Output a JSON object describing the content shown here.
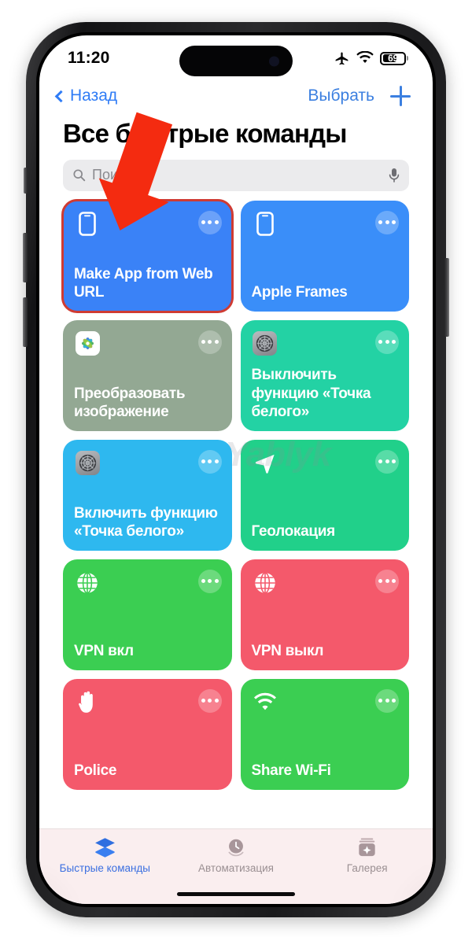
{
  "status_bar": {
    "time": "11:20",
    "airplane_icon": "airplane-mode-icon",
    "wifi_icon": "wifi-icon",
    "battery_percent": "69"
  },
  "nav_bar": {
    "back_label": "Назад",
    "select_label": "Выбрать",
    "add_label": "+"
  },
  "page": {
    "title": "Все быстрые команды"
  },
  "search": {
    "placeholder": "Поиск",
    "search_icon": "search-icon",
    "mic_icon": "microphone-icon"
  },
  "shortcuts": [
    {
      "label": "Make App from Web URL",
      "color": "#3a82f7",
      "icon": "iphone-icon",
      "highlighted": true
    },
    {
      "label": "Apple Frames",
      "color": "#3a8ef9",
      "icon": "iphone-icon",
      "highlighted": false
    },
    {
      "label": "Преобразовать изображение",
      "color": "#93a893",
      "icon": "photos-app-icon",
      "highlighted": false
    },
    {
      "label": "Выключить функцию «Точка белого»",
      "color": "#23d2a4",
      "icon": "settings-app-icon",
      "highlighted": false
    },
    {
      "label": "Включить функцию «Точка белого»",
      "color": "#2eb8ef",
      "icon": "settings-app-icon",
      "highlighted": false
    },
    {
      "label": "Геолокация",
      "color": "#21d08a",
      "icon": "location-arrow-icon",
      "highlighted": false
    },
    {
      "label": "VPN вкл",
      "color": "#3bce52",
      "icon": "globe-icon",
      "highlighted": false
    },
    {
      "label": "VPN выкл",
      "color": "#f4596b",
      "icon": "globe-icon",
      "highlighted": false
    },
    {
      "label": "Police",
      "color": "#f4596b",
      "icon": "hand-raised-icon",
      "highlighted": false
    },
    {
      "label": "Share Wi-Fi",
      "color": "#3bce52",
      "icon": "wifi-icon",
      "highlighted": false
    }
  ],
  "watermark": {
    "text": "Yablyk"
  },
  "tab_bar": {
    "tabs": [
      {
        "label": "Быстрые команды",
        "icon": "shortcuts-stack-icon",
        "active": true
      },
      {
        "label": "Автоматизация",
        "icon": "automation-clock-icon",
        "active": false
      },
      {
        "label": "Галерея",
        "icon": "gallery-sparkle-icon",
        "active": false
      }
    ]
  },
  "annotation": {
    "arrow_color": "#f42b10",
    "highlight_color": "#cf3b33"
  }
}
